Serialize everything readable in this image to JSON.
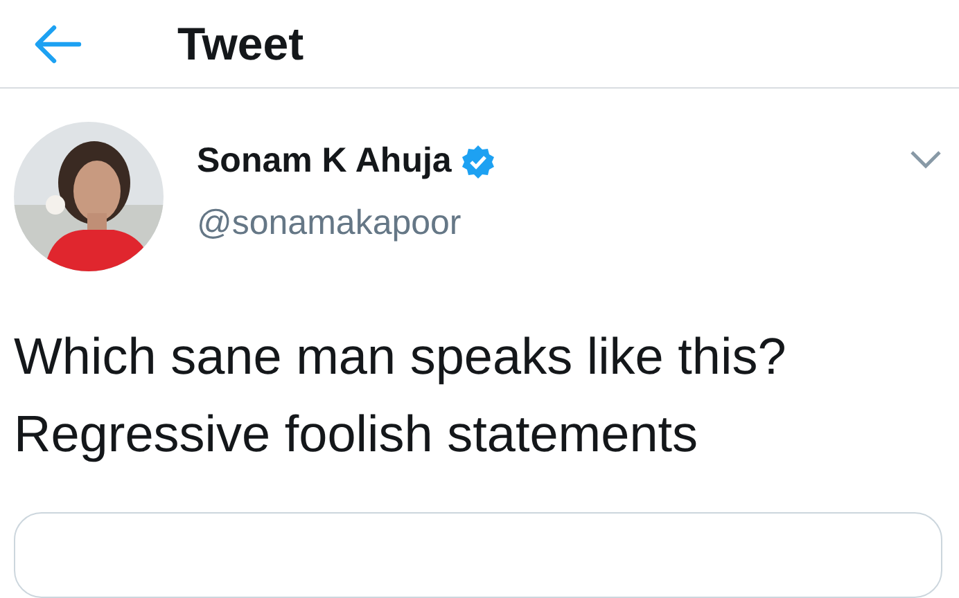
{
  "header": {
    "title": "Tweet"
  },
  "tweet": {
    "author": {
      "name": "Sonam K Ahuja",
      "verified": true,
      "handle": "@sonamakapoor"
    },
    "text_lines": [
      "Which sane man speaks like this?",
      "Regressive foolish statements"
    ]
  }
}
